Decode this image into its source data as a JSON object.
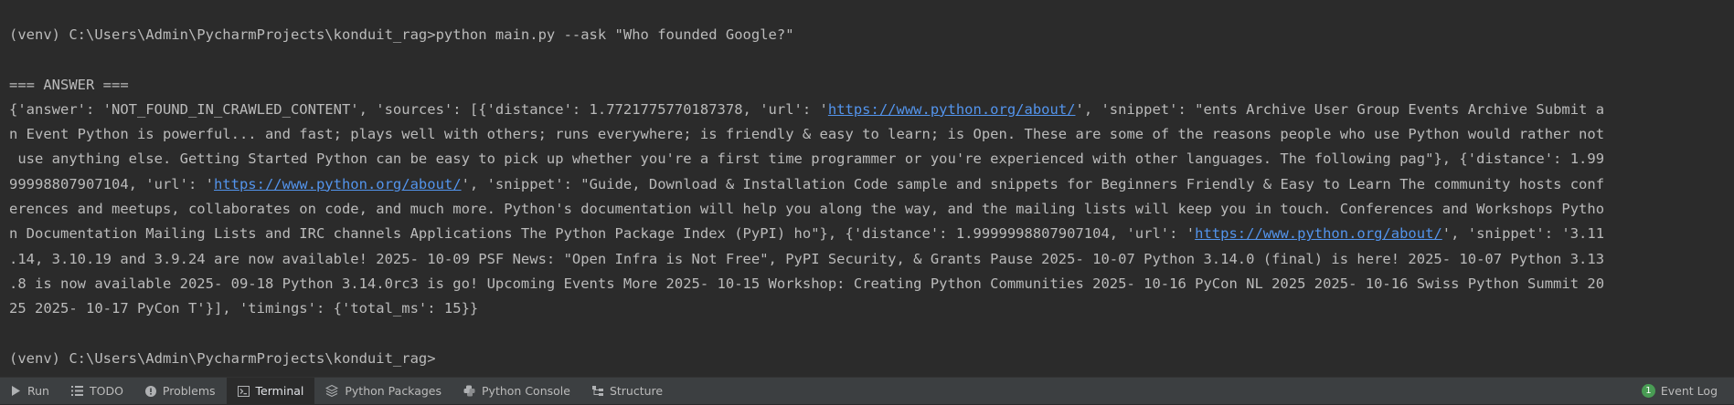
{
  "terminal": {
    "prompt_1": "(venv) C:\\Users\\Admin\\PycharmProjects\\konduit_rag>python main.py --ask \"Who founded Google?\"",
    "answer_header": "=== ANSWER ===",
    "out": {
      "l1a": "{'answer': 'NOT_FOUND_IN_CRAWLED_CONTENT', 'sources': [{'distance': 1.7721775770187378, 'url': '",
      "l1_link": "https://www.python.org/about/",
      "l1b": "', 'snippet': \"ents Archive User Group Events Archive Submit a",
      "l2": "n Event Python is powerful... and fast; plays well with others; runs everywhere; is friendly & easy to learn; is Open. These are some of the reasons people who use Python would rather not",
      "l3": " use anything else. Getting Started Python can be easy to pick up whether you're a first time programmer or you're experienced with other languages. The following pag\"}, {'distance': 1.99",
      "l4a": "99998807907104, 'url': '",
      "l4_link": "https://www.python.org/about/",
      "l4b": "', 'snippet': \"Guide, Download & Installation Code sample and snippets for Beginners Friendly & Easy to Learn The community hosts conf",
      "l5": "erences and meetups, collaborates on code, and much more. Python's documentation will help you along the way, and the mailing lists will keep you in touch. Conferences and Workshops Pytho",
      "l6a": "n Documentation Mailing Lists and IRC channels Applications The Python Package Index (PyPI) ho\"}, {'distance': 1.9999998807907104, 'url': '",
      "l6_link": "https://www.python.org/about/",
      "l6b": "', 'snippet': '3.11",
      "l7": ".14, 3.10.19 and 3.9.24 are now available! 2025- 10-09 PSF News: \"Open Infra is Not Free\", PyPI Security, & Grants Pause 2025- 10-07 Python 3.14.0 (final) is here! 2025- 10-07 Python 3.13",
      "l8": ".8 is now available 2025- 09-18 Python 3.14.0rc3 is go! Upcoming Events More 2025- 10-15 Workshop: Creating Python Communities 2025- 10-16 PyCon NL 2025 2025- 10-16 Swiss Python Summit 20",
      "l9": "25 2025- 10-17 PyCon T'}], 'timings': {'total_ms': 15}}"
    },
    "prompt_2": "(venv) C:\\Users\\Admin\\PycharmProjects\\konduit_rag>"
  },
  "toolbar": {
    "run": "Run",
    "todo": "TODO",
    "problems": "Problems",
    "terminal": "Terminal",
    "python_packages": "Python Packages",
    "python_console": "Python Console",
    "structure": "Structure",
    "event_log": "Event Log",
    "event_log_count": "1"
  },
  "colors": {
    "background": "#2b2b2b",
    "text": "#bbbbbb",
    "link": "#5394ec",
    "toolbar": "#3c3f41",
    "badge": "#499c54"
  },
  "icons": [
    "run-icon",
    "todo-icon",
    "problems-icon",
    "terminal-icon",
    "packages-icon",
    "python-console-icon",
    "structure-icon",
    "event-log-icon"
  ]
}
